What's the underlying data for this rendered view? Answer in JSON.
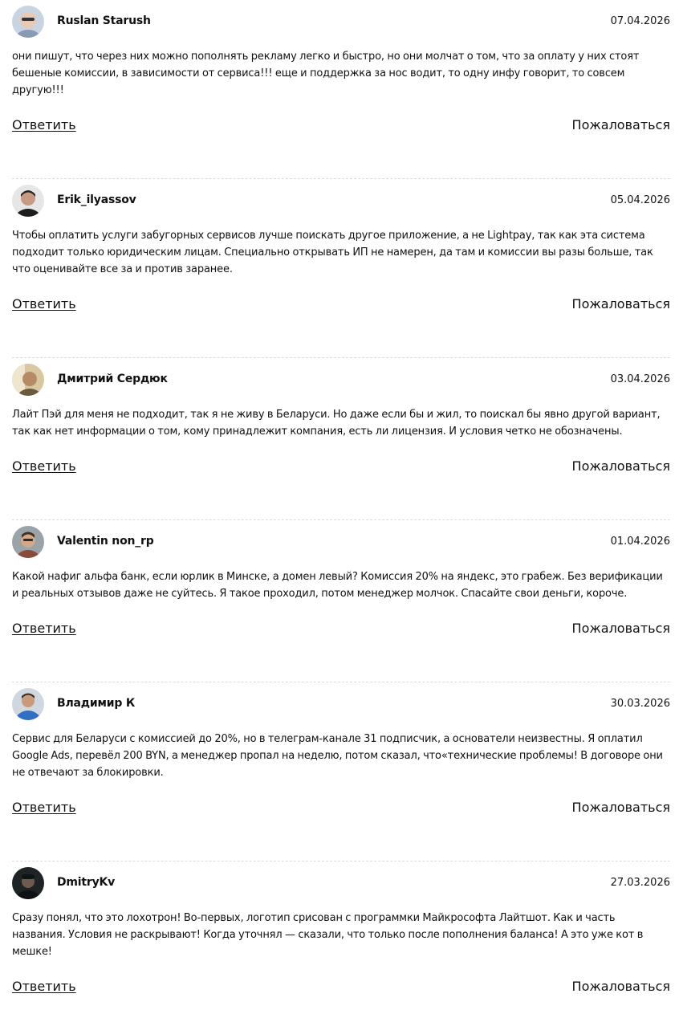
{
  "comments": [
    {
      "author": "Ruslan Starush",
      "date": "07.04.2026",
      "text": "они пишут, что через них можно пополнять рекламу легко и быстро, но они молчат о том, что за оплату у них стоят бешеные комиссии, в зависимости от сервиса!!! еще и поддержка за нос водит, то одну инфу говорит, то совсем другую!!!",
      "reply_label": "Ответить",
      "complain_label": "Пожаловаться"
    },
    {
      "author": "Erik_ilyassov",
      "date": "05.04.2026",
      "text": "Чтобы оплатить услуги забугорных сервисов лучше поискать другое приложение, а не Lightpay, так как эта система подходит только юридическим лицам. Специально открывать ИП не намерен, да там и комиссии вы разы больше, так что оценивайте все за и против заранее.",
      "reply_label": "Ответить",
      "complain_label": "Пожаловаться"
    },
    {
      "author": "Дмитрий Сердюк",
      "date": "03.04.2026",
      "text": "Лайт Пэй для меня не подходит, так я не живу в Беларуси. Но даже если бы и жил, то поискал бы явно другой вариант, так как нет информации о том, кому принадлежит компания, есть ли лицензия. И условия четко не обозначены.",
      "reply_label": "Ответить",
      "complain_label": "Пожаловаться"
    },
    {
      "author": "Valentin non_rp",
      "date": "01.04.2026",
      "text": "Какой нафиг альфа банк, если юрлик в Минске, а домен левый? Комиссия 20% на яндекс, это грабеж. Без верификации и реальных отзывов даже не суйтесь. Я такое проходил, потом менеджер молчок. Спасайте свои деньги, короче.",
      "reply_label": "Ответить",
      "complain_label": "Пожаловаться"
    },
    {
      "author": "Владимир К",
      "date": "30.03.2026",
      "text": "Сервис для Беларуси с комиссией до 20%, но в телеграм-канале 31 подписчик, а основатели неизвестны. Я оплатил Google Ads, перевёл 200 BYN, а менеджер пропал на неделю, потом сказал, что«технические проблемы! В договоре они не отвечают за блокировки.",
      "reply_label": "Ответить",
      "complain_label": "Пожаловаться"
    },
    {
      "author": "DmitryKv",
      "date": "27.03.2026",
      "text": "Сразу понял, что это лохотрон! Во-первых, логотип срисован с программки Майкрософта Лайтшот. Как и часть названия. Условия не раскрывают! Когда уточнял — сказали, что только после пополнения баланса! А это уже кот в мешке!",
      "reply_label": "Ответить",
      "complain_label": "Пожаловаться"
    }
  ],
  "colors": {
    "text": "#111111",
    "separator": "#dcdcdc"
  },
  "icons": {
    "avatar": "user-avatar-photo"
  }
}
